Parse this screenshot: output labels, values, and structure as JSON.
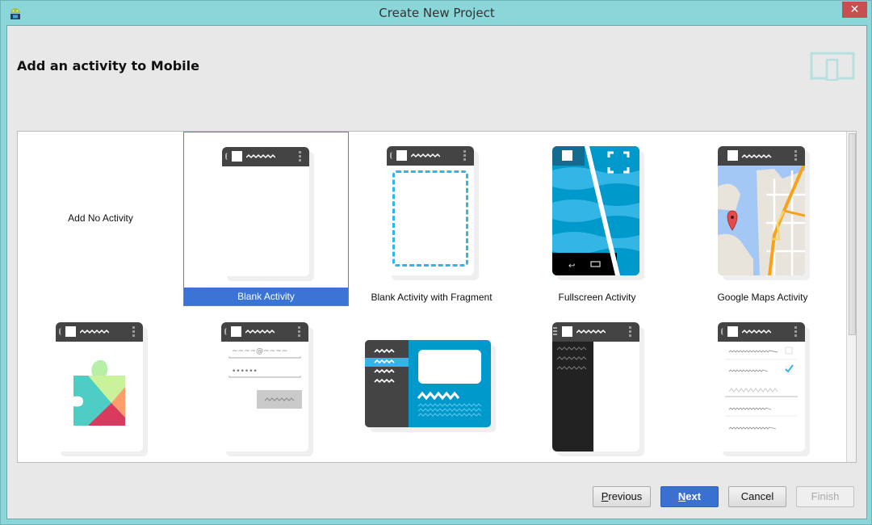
{
  "window": {
    "title": "Create New Project",
    "close_icon": "close-icon",
    "app_icon": "android-studio-icon"
  },
  "page": {
    "heading": "Add an activity to Mobile",
    "form_factor_icon": "phone-tablet-icon"
  },
  "gallery": {
    "selected": "Blank Activity",
    "tiles": [
      {
        "label": "Add No Activity",
        "preview": "none"
      },
      {
        "label": "Blank Activity",
        "preview": "blank-phone"
      },
      {
        "label": "Blank Activity with Fragment",
        "preview": "fragment-phone"
      },
      {
        "label": "Fullscreen Activity",
        "preview": "fullscreen-phone"
      },
      {
        "label": "Google Maps Activity",
        "preview": "maps-phone"
      },
      {
        "label": "",
        "preview": "play-services-phone"
      },
      {
        "label": "",
        "preview": "login-phone"
      },
      {
        "label": "",
        "preview": "master-detail-tablet"
      },
      {
        "label": "",
        "preview": "navigation-drawer-phone"
      },
      {
        "label": "",
        "preview": "settings-phone"
      }
    ]
  },
  "footer": {
    "previous": {
      "label_mnemonic": "P",
      "label_rest": "revious"
    },
    "next": {
      "label_mnemonic": "N",
      "label_rest": "ext"
    },
    "cancel": {
      "label": "Cancel"
    },
    "finish": {
      "label": "Finish",
      "enabled": false
    }
  },
  "colors": {
    "chrome": "#8ad6d9",
    "selection": "#3c74d5",
    "close": "#c74f4f",
    "accent_blue": "#33b5e5"
  }
}
